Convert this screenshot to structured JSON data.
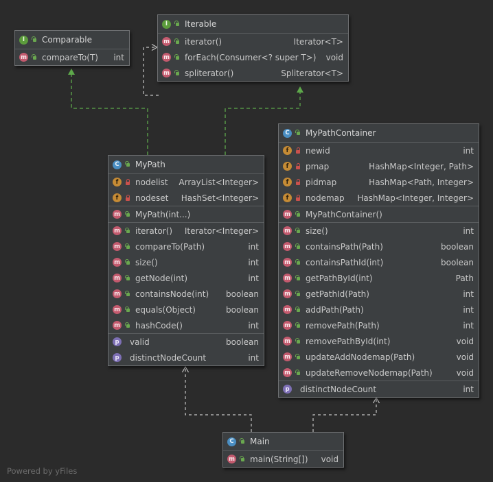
{
  "footer": "Powered by yFiles",
  "classes": {
    "comparable": {
      "badge": "I",
      "name": "Comparable",
      "sections": [
        [
          {
            "kind": "m",
            "vis": "pub",
            "name": "compareTo(T)",
            "type": "int"
          }
        ]
      ]
    },
    "iterable": {
      "badge": "I",
      "name": "Iterable",
      "sections": [
        [
          {
            "kind": "m",
            "vis": "pub",
            "name": "iterator()",
            "type": "Iterator<T>"
          },
          {
            "kind": "m",
            "vis": "pub",
            "name": "forEach(Consumer<? super T>)",
            "type": "void"
          },
          {
            "kind": "m",
            "vis": "pub",
            "name": "spliterator()",
            "type": "Spliterator<T>"
          }
        ]
      ]
    },
    "mypath": {
      "badge": "C",
      "name": "MyPath",
      "sections": [
        [
          {
            "kind": "f",
            "vis": "pri",
            "name": "nodelist",
            "type": "ArrayList<Integer>"
          },
          {
            "kind": "f",
            "vis": "pri",
            "name": "nodeset",
            "type": "HashSet<Integer>"
          }
        ],
        [
          {
            "kind": "m",
            "vis": "pub",
            "name": "MyPath(int...)",
            "type": ""
          }
        ],
        [
          {
            "kind": "m",
            "vis": "pub",
            "name": "iterator()",
            "type": "Iterator<Integer>"
          },
          {
            "kind": "m",
            "vis": "pub",
            "name": "compareTo(Path)",
            "type": "int"
          },
          {
            "kind": "m",
            "vis": "pub",
            "name": "size()",
            "type": "int"
          },
          {
            "kind": "m",
            "vis": "pub",
            "name": "getNode(int)",
            "type": "int"
          },
          {
            "kind": "m",
            "vis": "pub",
            "name": "containsNode(int)",
            "type": "boolean"
          },
          {
            "kind": "m",
            "vis": "pub",
            "name": "equals(Object)",
            "type": "boolean"
          },
          {
            "kind": "m",
            "vis": "pub",
            "name": "hashCode()",
            "type": "int"
          }
        ],
        [
          {
            "kind": "p",
            "vis": "",
            "name": "valid",
            "type": "boolean"
          },
          {
            "kind": "p",
            "vis": "",
            "name": "distinctNodeCount",
            "type": "int"
          }
        ]
      ]
    },
    "mypathcontainer": {
      "badge": "C",
      "name": "MyPathContainer",
      "sections": [
        [
          {
            "kind": "f",
            "vis": "pri",
            "name": "newid",
            "type": "int"
          },
          {
            "kind": "f",
            "vis": "pri",
            "name": "pmap",
            "type": "HashMap<Integer, Path>"
          },
          {
            "kind": "f",
            "vis": "pri",
            "name": "pidmap",
            "type": "HashMap<Path, Integer>"
          },
          {
            "kind": "f",
            "vis": "pri",
            "name": "nodemap",
            "type": "HashMap<Integer, Integer>"
          }
        ],
        [
          {
            "kind": "m",
            "vis": "pub",
            "name": "MyPathContainer()",
            "type": ""
          }
        ],
        [
          {
            "kind": "m",
            "vis": "pub",
            "name": "size()",
            "type": "int"
          },
          {
            "kind": "m",
            "vis": "pub",
            "name": "containsPath(Path)",
            "type": "boolean"
          },
          {
            "kind": "m",
            "vis": "pub",
            "name": "containsPathId(int)",
            "type": "boolean"
          },
          {
            "kind": "m",
            "vis": "pub",
            "name": "getPathById(int)",
            "type": "Path"
          },
          {
            "kind": "m",
            "vis": "pub",
            "name": "getPathId(Path)",
            "type": "int"
          },
          {
            "kind": "m",
            "vis": "pub",
            "name": "addPath(Path)",
            "type": "int"
          },
          {
            "kind": "m",
            "vis": "pub",
            "name": "removePath(Path)",
            "type": "int"
          },
          {
            "kind": "m",
            "vis": "pub",
            "name": "removePathById(int)",
            "type": "void"
          },
          {
            "kind": "m",
            "vis": "pub",
            "name": "updateAddNodemap(Path)",
            "type": "void"
          },
          {
            "kind": "m",
            "vis": "pub",
            "name": "updateRemoveNodemap(Path)",
            "type": "void"
          }
        ],
        [
          {
            "kind": "p",
            "vis": "",
            "name": "distinctNodeCount",
            "type": "int"
          }
        ]
      ]
    },
    "main": {
      "badge": "C",
      "name": "Main",
      "sections": [
        [
          {
            "kind": "m",
            "vis": "pub",
            "name": "main(String[])",
            "type": "void"
          }
        ]
      ]
    }
  },
  "colors": {
    "implements_edge": "#5ea94b",
    "dependency_edge": "#c5c5c5",
    "background": "#2b2b2b",
    "node_fill": "#3c3f41"
  }
}
